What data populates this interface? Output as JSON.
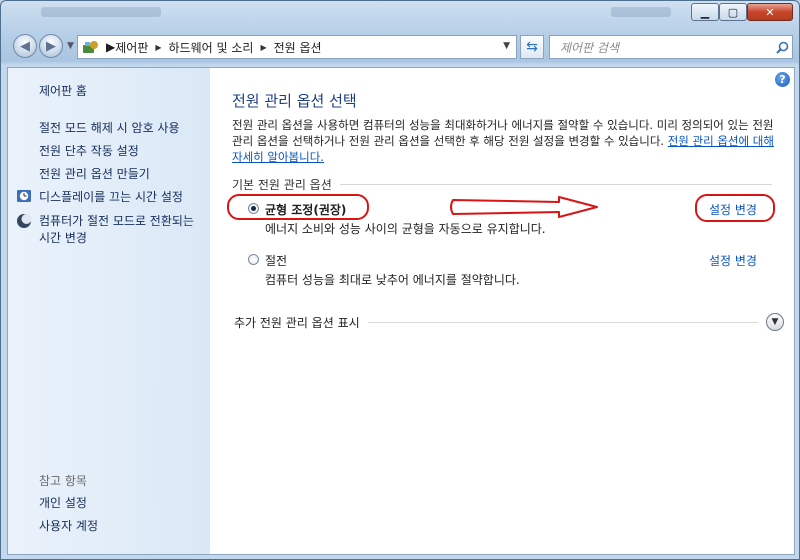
{
  "nav": {
    "breadcrumbs": [
      "제어판",
      "하드웨어 및 소리",
      "전원 옵션"
    ],
    "search_placeholder": "제어판 검색"
  },
  "sidebar": {
    "home": "제어판 홈",
    "links": [
      {
        "label": "절전 모드 해제 시 암호 사용",
        "icon": "none"
      },
      {
        "label": "전원 단추 작동 설정",
        "icon": "none"
      },
      {
        "label": "전원 관리 옵션 만들기",
        "icon": "none"
      },
      {
        "label": "디스플레이를 끄는 시간 설정",
        "icon": "clock-icon"
      },
      {
        "label": "컴퓨터가 절전 모드로 전환되는 시간 변경",
        "icon": "moon-icon"
      }
    ],
    "see_also_heading": "참고 항목",
    "see_also": [
      "개인 설정",
      "사용자 계정"
    ]
  },
  "main": {
    "title": "전원 관리 옵션 선택",
    "description": "전원 관리 옵션을 사용하면 컴퓨터의 성능을 최대화하거나 에너지를 절약할 수 있습니다. 미리 정의되어 있는 전원 관리 옵션을 선택하거나 전원 관리 옵션을 선택한 후 해당 전원 설정을 변경할 수 있습니다.",
    "learn_more_link": "전원 관리 옵션에 대해 자세히 알아봅니다.",
    "section_heading": "기본 전원 관리 옵션",
    "plans": [
      {
        "name": "균형 조정(권장)",
        "description": "에너지 소비와 성능 사이의 균형을 자동으로 유지합니다.",
        "selected": true,
        "change_link": "설정 변경"
      },
      {
        "name": "절전",
        "description": "컴퓨터 성능을 최대로 낮추어 에너지를 절약합니다.",
        "selected": false,
        "change_link": "설정 변경"
      }
    ],
    "more_plans": "추가 전원 관리 옵션 표시"
  },
  "colors": {
    "annotation": "#d81414",
    "link": "#0a55c4",
    "title": "#1e3f86"
  }
}
